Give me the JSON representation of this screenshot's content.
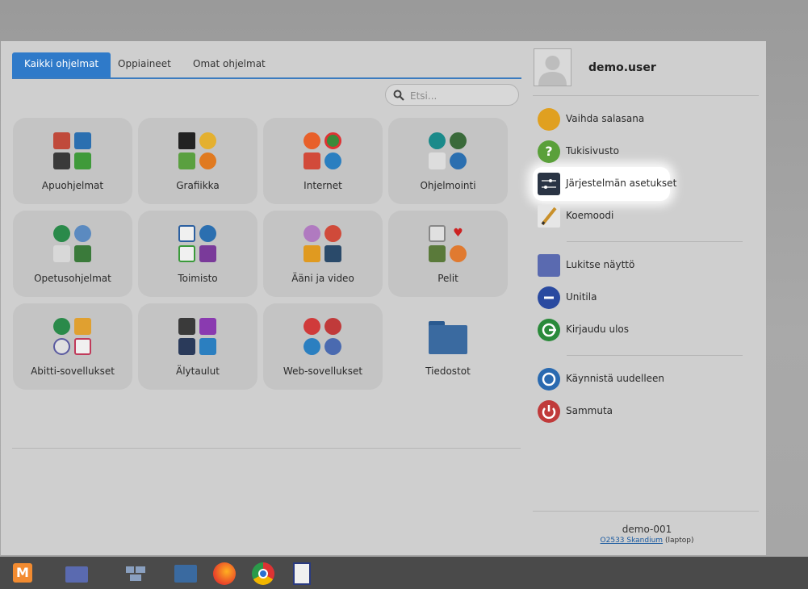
{
  "tabs": [
    "Kaikki ohjelmat",
    "Oppiaineet",
    "Omat ohjelmat"
  ],
  "search": {
    "placeholder": "Etsi..."
  },
  "categories": [
    "Apuohjelmat",
    "Grafiikka",
    "Internet",
    "Ohjelmointi",
    "Opetusohjelmat",
    "Toimisto",
    "Ääni ja video",
    "Pelit",
    "Abitti-sovellukset",
    "Älytaulut",
    "Web-sovellukset",
    "Tiedostot"
  ],
  "user": {
    "name": "demo.user"
  },
  "actions": [
    "Vaihda salasana",
    "Tukisivusto",
    "Järjestelmän asetukset",
    "Koemoodi",
    "Lukitse näyttö",
    "Unitila",
    "Kirjaudu ulos",
    "Käynnistä uudelleen",
    "Sammuta"
  ],
  "host": {
    "name": "demo-001",
    "model_link": "O2533 Skandium",
    "type": "(laptop)"
  },
  "colors": {
    "accent": "#2f7ac9",
    "menu_bg": "#cfcfcf",
    "taskbar": "#4a4a4a"
  },
  "taskbar": [
    "menu-launcher",
    "workspace-switcher",
    "window-list",
    "files",
    "firefox",
    "chrome",
    "text-editor"
  ]
}
